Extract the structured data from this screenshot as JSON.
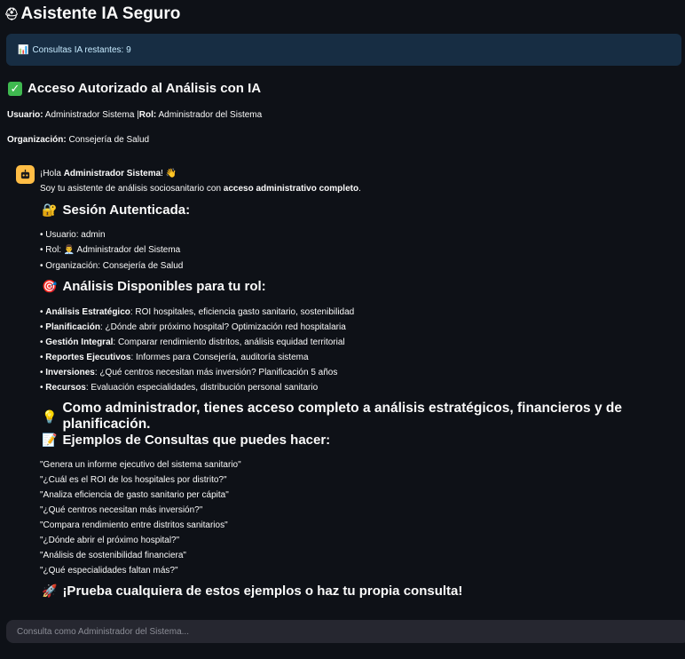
{
  "app": {
    "title": "Asistente IA Seguro",
    "title_icon": "shield-lock-icon"
  },
  "info": {
    "text": "Consultas IA restantes: 9",
    "icon": "bar-chart-icon"
  },
  "access": {
    "heading": "Acceso Autorizado al Análisis con IA",
    "usuario_label": "Usuario:",
    "usuario_value": "Administrador Sistema",
    "separator": "|",
    "rol_label": "Rol:",
    "rol_value": "Administrador del Sistema",
    "org_label": "Organización:",
    "org_value": "Consejería de Salud"
  },
  "message": {
    "greeting_prefix": "¡Hola",
    "greeting_name": "Administrador Sistema",
    "greeting_suffix": "! 👋",
    "intro_prefix": "Soy tu asistente de análisis sociosanitario con",
    "intro_bold": "acceso administrativo completo",
    "intro_suffix": ".",
    "session_heading": "Sesión Autenticada:",
    "session_items": [
      "• Usuario: admin",
      "• Rol: 👨‍💼 Administrador del Sistema",
      "• Organización: Consejería de Salud"
    ],
    "analysis_heading": "Análisis Disponibles para tu rol:",
    "analysis_items": [
      {
        "label": "Análisis Estratégico",
        "text": ": ROI hospitales, eficiencia gasto sanitario, sostenibilidad"
      },
      {
        "label": "Planificación",
        "text": ": ¿Dónde abrir próximo hospital? Optimización red hospitalaria"
      },
      {
        "label": "Gestión Integral",
        "text": ": Comparar rendimiento distritos, análisis equidad territorial"
      },
      {
        "label": "Reportes Ejecutivos",
        "text": ": Informes para Consejería, auditoría sistema"
      },
      {
        "label": "Inversiones",
        "text": ": ¿Qué centros necesitan más inversión? Planificación 5 años"
      },
      {
        "label": "Recursos",
        "text": ": Evaluación especialidades, distribución personal sanitario"
      }
    ],
    "admin_note": "Como administrador, tienes acceso completo a análisis estratégicos, financieros y de planificación.",
    "examples_heading": "Ejemplos de Consultas que puedes hacer:",
    "examples": [
      "\"Genera un informe ejecutivo del sistema sanitario\"",
      "\"¿Cuál es el ROI de los hospitales por distrito?\"",
      "\"Analiza eficiencia de gasto sanitario per cápita\"",
      "\"¿Qué centros necesitan más inversión?\"",
      "\"Compara rendimiento entre distritos sanitarios\"",
      "\"¿Dónde abrir el próximo hospital?\"",
      "\"Análisis de sostenibilidad financiera\"",
      "\"¿Qué especialidades faltan más?\""
    ],
    "cta": "¡Prueba cualquiera de estos ejemplos o haz tu propia consulta!"
  },
  "chat": {
    "placeholder": "Consulta como Administrador del Sistema..."
  },
  "colors": {
    "background": "#0e1117",
    "info_bg": "#172d43",
    "info_text": "#c7ebff",
    "success": "#3fb950",
    "avatar": "#ffbd45",
    "input_bg": "#262730"
  }
}
